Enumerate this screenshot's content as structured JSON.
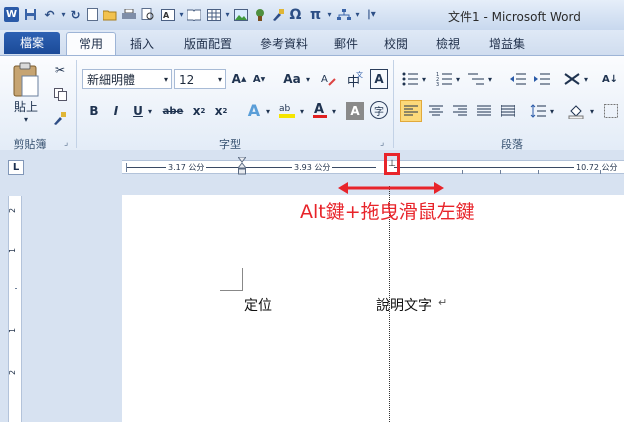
{
  "window": {
    "title": "文件1 - Microsoft Word"
  },
  "tabs": [
    "檔案",
    "常用",
    "插入",
    "版面配置",
    "參考資料",
    "郵件",
    "校閱",
    "檢視",
    "增益集"
  ],
  "clipboard": {
    "paste_label": "貼上",
    "group_label": "剪貼簿"
  },
  "font": {
    "name": "新細明體",
    "size": "12",
    "group_label": "字型",
    "aa_label": "Aa"
  },
  "paragraph": {
    "group_label": "段落"
  },
  "ruler": {
    "labels": [
      "3.17 公分",
      "3.93 公分",
      "10.72 公分"
    ]
  },
  "vruler": {
    "numbers": [
      "2",
      "1",
      "1",
      "2"
    ]
  },
  "document": {
    "left_text": "定位",
    "right_text": "說明文字"
  },
  "annotation": {
    "text": "Alt鍵+拖曳滑鼠左鍵",
    "color": "#e8242a"
  }
}
